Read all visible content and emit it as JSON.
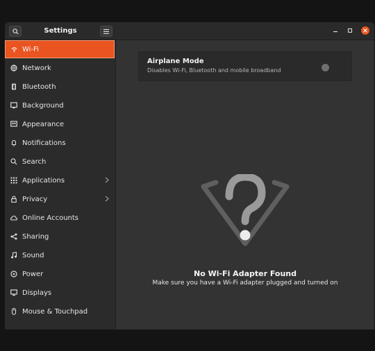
{
  "window": {
    "title": "Settings"
  },
  "sidebar": {
    "items": [
      {
        "label": "Wi-Fi",
        "icon": "wifi-icon",
        "active": true
      },
      {
        "label": "Network",
        "icon": "network-icon"
      },
      {
        "label": "Bluetooth",
        "icon": "bluetooth-icon"
      },
      {
        "label": "Background",
        "icon": "background-icon"
      },
      {
        "label": "Appearance",
        "icon": "appearance-icon"
      },
      {
        "label": "Notifications",
        "icon": "bell-icon"
      },
      {
        "label": "Search",
        "icon": "search-icon"
      },
      {
        "label": "Applications",
        "icon": "applications-grid-icon",
        "chevron": true
      },
      {
        "label": "Privacy",
        "icon": "lock-icon",
        "chevron": true
      },
      {
        "label": "Online Accounts",
        "icon": "cloud-icon"
      },
      {
        "label": "Sharing",
        "icon": "share-icon"
      },
      {
        "label": "Sound",
        "icon": "music-note-icon"
      },
      {
        "label": "Power",
        "icon": "power-icon"
      },
      {
        "label": "Displays",
        "icon": "display-icon"
      },
      {
        "label": "Mouse & Touchpad",
        "icon": "mouse-icon"
      }
    ]
  },
  "airplane_mode": {
    "title": "Airplane Mode",
    "subtitle": "Disables Wi-Fi, Bluetooth and mobile broadband",
    "enabled": false
  },
  "empty_state": {
    "title": "No Wi-Fi Adapter Found",
    "subtitle": "Make sure you have a Wi-Fi adapter plugged and turned on",
    "icon": "wifi-question-icon"
  },
  "colors": {
    "accent": "#e95420",
    "background": "#333333",
    "sidebar": "#2b2b2b"
  }
}
